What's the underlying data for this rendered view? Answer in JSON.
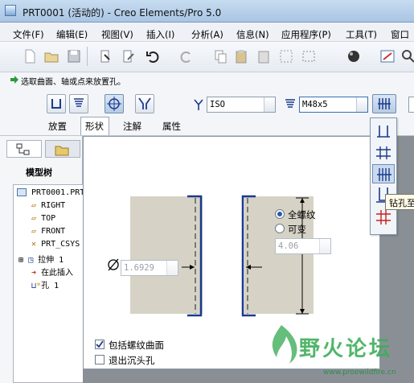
{
  "window": {
    "title": "PRT0001 (活动的) - Creo Elements/Pro 5.0"
  },
  "menu": [
    "文件(F)",
    "编辑(E)",
    "视图(V)",
    "插入(I)",
    "分析(A)",
    "信息(N)",
    "应用程序(P)",
    "工具(T)",
    "窗口"
  ],
  "prompt": "选取曲面、轴或点来放置孔。",
  "dashboard": {
    "standard_value": "ISO",
    "size_value": "M48x5",
    "tabs": [
      "放置",
      "形状",
      "注解",
      "属性"
    ],
    "active_tab": "形状"
  },
  "model_tree": {
    "title": "模型树",
    "items": [
      "PRT0001.PRT",
      "RIGHT",
      "TOP",
      "FRONT",
      "PRT_CSYS",
      "拉伸 1",
      "在此插入",
      "孔 1"
    ]
  },
  "shape_panel": {
    "diameter_value": "1.6929",
    "thread_option_full": "全螺纹",
    "thread_option_variable": "可变",
    "depth_value": "4.06",
    "include_thread_surface_label": "包括螺纹曲面",
    "include_thread_surface_checked": true,
    "exit_countersink_label": "退出沉头孔",
    "exit_countersink_checked": false
  },
  "tooltip": "钻孔至",
  "watermark": {
    "text": "野火论坛",
    "url": "www.proewildfire.cn"
  },
  "colors": {
    "accent": "#1b3a8c",
    "thread_fill": "#d6d3c6",
    "watermark": "#3fae5a"
  }
}
